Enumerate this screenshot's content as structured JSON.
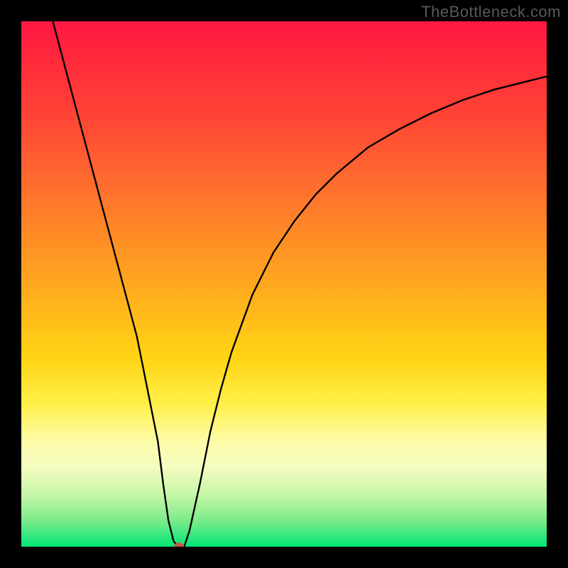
{
  "watermark": "TheBottleneck.com",
  "marker_color": "#c85a4a",
  "curve_stroke": "#000000",
  "chart_data": {
    "type": "line",
    "title": "",
    "xlabel": "",
    "ylabel": "",
    "xlim": [
      0,
      100
    ],
    "ylim": [
      0,
      100
    ],
    "grid": false,
    "legend": false,
    "series": [
      {
        "name": "curve",
        "x": [
          6,
          10,
          14,
          18,
          22,
          24,
          26,
          27,
          28,
          29,
          30,
          31,
          32,
          34,
          36,
          38,
          40,
          44,
          48,
          52,
          56,
          60,
          66,
          72,
          78,
          84,
          90,
          96,
          100
        ],
        "y": [
          100,
          85,
          70,
          55,
          40,
          30,
          20,
          12,
          5,
          1,
          0,
          0,
          3,
          12,
          22,
          30,
          37,
          48,
          56,
          62,
          67,
          71,
          76,
          79.5,
          82.5,
          85,
          87,
          88.5,
          89.5
        ]
      }
    ],
    "marker": {
      "x": 30,
      "y": 0
    }
  }
}
